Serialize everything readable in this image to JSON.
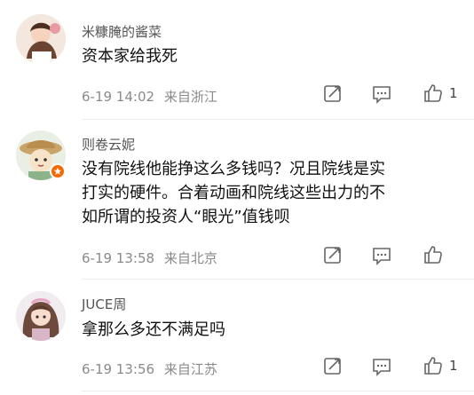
{
  "comments": [
    {
      "username": "米糠腌的酱菜",
      "content_lines": [
        "资本家给我死"
      ],
      "time": "6-19 14:02",
      "location": "来自浙江",
      "likes": "1"
    },
    {
      "username": "则卷云妮",
      "content_lines": [
        "没有院线他能挣这么多钱吗？况且院线是实",
        "打实的硬件。合着动画和院线这些出力的不",
        "如所谓的投资人“眼光”值钱呗"
      ],
      "time": "6-19 13:58",
      "location": "来自北京",
      "likes": ""
    },
    {
      "username": "JUCE周",
      "content_lines": [
        "拿那么多还不满足吗"
      ],
      "time": "6-19 13:56",
      "location": "来自江苏",
      "likes": "1"
    }
  ],
  "icons": {
    "share": "share-icon",
    "comment": "comment-icon",
    "like": "thumbs-up-icon"
  }
}
